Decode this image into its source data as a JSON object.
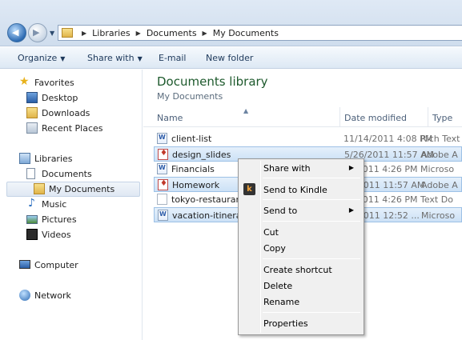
{
  "address": {
    "crumbs": [
      "Libraries",
      "Documents",
      "My Documents"
    ]
  },
  "toolbar": {
    "organize": "Organize",
    "share_with": "Share with",
    "email": "E-mail",
    "new_folder": "New folder"
  },
  "nav": {
    "favorites": "Favorites",
    "desktop": "Desktop",
    "downloads": "Downloads",
    "recent_places": "Recent Places",
    "libraries": "Libraries",
    "documents": "Documents",
    "my_documents": "My Documents",
    "music": "Music",
    "pictures": "Pictures",
    "videos": "Videos",
    "computer": "Computer",
    "network": "Network"
  },
  "content": {
    "title": "Documents library",
    "subtitle": "My Documents",
    "columns": {
      "name": "Name",
      "date": "Date modified",
      "type": "Type"
    }
  },
  "files": [
    {
      "name": "client-list",
      "date": "11/14/2011 4:08 PM",
      "type": "Rich Text",
      "icon": "word-doc-icon"
    },
    {
      "name": "design_slides",
      "date": "5/26/2011 11:57 AM",
      "type": "Adobe A",
      "icon": "pdf-icon"
    },
    {
      "name": "Financials",
      "date": "8/2011 4:26 PM",
      "type": "Microso",
      "icon": "word-doc-icon"
    },
    {
      "name": "Homework",
      "date": "8/2011 11:57 AM",
      "type": "Adobe A",
      "icon": "pdf-icon"
    },
    {
      "name": "tokyo-restaurants",
      "date": "8/2011 4:26 PM",
      "type": "Text Do",
      "icon": "text-doc-icon"
    },
    {
      "name": "vacation-itinerary",
      "date": "7/2011 12:52 ...",
      "type": "Microso",
      "icon": "word-doc-icon"
    }
  ],
  "context_menu": {
    "share_with": "Share with",
    "send_to_kindle": "Send to Kindle",
    "send_to": "Send to",
    "cut": "Cut",
    "copy": "Copy",
    "create_shortcut": "Create shortcut",
    "delete": "Delete",
    "rename": "Rename",
    "properties": "Properties"
  },
  "icons": {
    "kindle_glyph": "k",
    "submenu_arrow": "▶"
  }
}
